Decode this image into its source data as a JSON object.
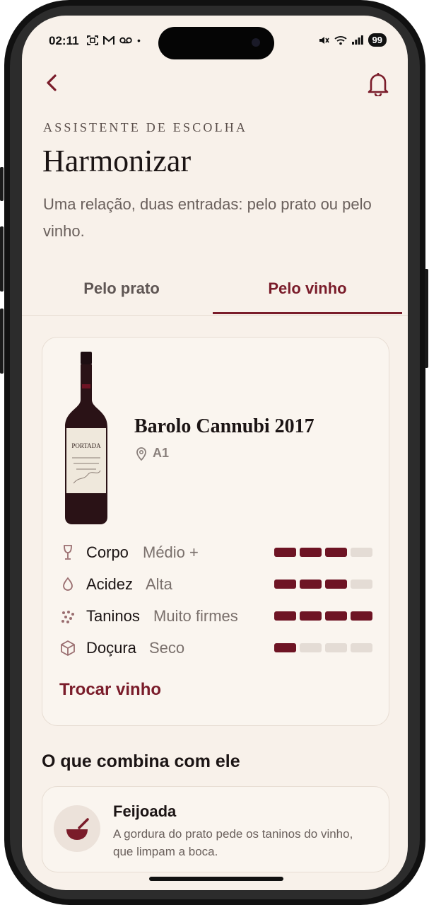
{
  "status_bar": {
    "time": "02:11",
    "battery": "99"
  },
  "header": {
    "eyebrow": "ASSISTENTE DE ESCOLHA",
    "title": "Harmonizar",
    "subtitle": "Uma relação, duas entradas: pelo prato ou pelo vinho."
  },
  "tabs": [
    {
      "label": "Pelo prato",
      "active": false
    },
    {
      "label": "Pelo vinho",
      "active": true
    }
  ],
  "wine": {
    "name": "Barolo Cannubi 2017",
    "location": "A1",
    "bottle_label": "PORTADA",
    "attributes": [
      {
        "icon": "wine-glass-icon",
        "label": "Corpo",
        "value": "Médio +",
        "level": 3,
        "max": 4
      },
      {
        "icon": "droplet-icon",
        "label": "Acidez",
        "value": "Alta",
        "level": 3,
        "max": 4
      },
      {
        "icon": "dots-icon",
        "label": "Taninos",
        "value": "Muito firmes",
        "level": 4,
        "max": 4
      },
      {
        "icon": "cube-icon",
        "label": "Doçura",
        "value": "Seco",
        "level": 1,
        "max": 4
      }
    ],
    "change_label": "Trocar vinho"
  },
  "pairings": {
    "section_title": "O que combina com ele",
    "items": [
      {
        "icon": "bowl-icon",
        "name": "Feijoada",
        "description": "A gordura do prato pede os taninos do vinho, que limpam a boca."
      }
    ]
  },
  "colors": {
    "accent": "#7a1c2a",
    "background": "#f8f1ea",
    "bar_on": "#6e1424",
    "bar_off": "#e4dcd5"
  }
}
